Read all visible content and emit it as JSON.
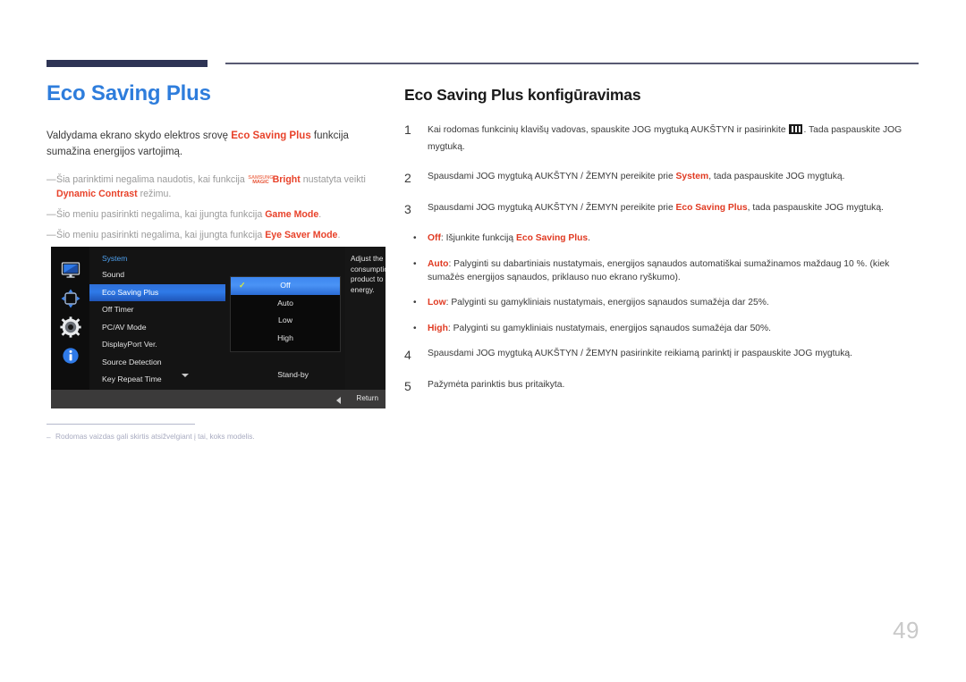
{
  "page": {
    "number": "49"
  },
  "left": {
    "title": "Eco Saving Plus",
    "intro_pre": "Valdydama ekrano skydo elektros srovę ",
    "intro_highlight": "Eco Saving Plus",
    "intro_post": " funkcija sumažina energijos vartojimą.",
    "dash": "—",
    "notes": [
      {
        "pre": "Šia parinktimi negalima naudotis, kai funkcija ",
        "logo_line1": "SAMSUNG",
        "logo_line2": "MAGIC",
        "bold1": "Bright",
        "mid": " nustatyta veikti ",
        "bold2": "Dynamic Contrast",
        "post": " režimu."
      },
      {
        "pre": "Šio meniu pasirinkti negalima, kai įjungta funkcija ",
        "bold1": "Game Mode",
        "post": "."
      },
      {
        "pre": "Šio meniu pasirinkti negalima, kai įjungta funkcija ",
        "bold1": "Eye Saver Mode",
        "post": "."
      }
    ],
    "footnote": {
      "dash": "–",
      "text": "Rodomas vaizdas gali skirtis atsižvelgiant į tai, koks modelis."
    }
  },
  "osd": {
    "section_title": "System",
    "sidebar_icons": [
      "monitor-icon",
      "screen-adjust-icon",
      "gear-icon",
      "info-icon"
    ],
    "menu_items": [
      {
        "label": "Sound",
        "selected": false
      },
      {
        "label": "Eco Saving Plus",
        "selected": true
      },
      {
        "label": "Off Timer",
        "selected": false
      },
      {
        "label": "PC/AV Mode",
        "selected": false
      },
      {
        "label": "DisplayPort Ver.",
        "selected": false
      },
      {
        "label": "Source Detection",
        "selected": false
      },
      {
        "label": "Key Repeat Time",
        "selected": false
      }
    ],
    "standby_value": "Stand-by",
    "options": [
      {
        "label": "Off",
        "selected": true
      },
      {
        "label": "Auto",
        "selected": false
      },
      {
        "label": "Low",
        "selected": false
      },
      {
        "label": "High",
        "selected": false
      }
    ],
    "check_glyph": "✓",
    "description": "Adjust the power consumption of the product to save energy.",
    "return_label": "Return"
  },
  "right": {
    "title": "Eco Saving Plus konfigūravimas",
    "steps": [
      {
        "num": "1",
        "pre": "Kai rodomas funkcinių klavišų vadovas, spauskite JOG mygtuką AUKŠTYN ir pasirinkite ",
        "icon": "menu-key-icon",
        "post": ". Tada paspauskite JOG mygtuką."
      },
      {
        "num": "2",
        "pre": "Spausdami JOG mygtuką AUKŠTYN / ŽEMYN pereikite prie ",
        "bold1": "System",
        "post": ", tada paspauskite JOG mygtuką."
      },
      {
        "num": "3",
        "pre": "Spausdami JOG mygtuką AUKŠTYN / ŽEMYN pereikite prie ",
        "bold1": "Eco Saving Plus",
        "post": ", tada paspauskite JOG mygtuką."
      }
    ],
    "bullet_char": "•",
    "bullets": [
      {
        "bold1": "Off",
        "mid": ": Išjunkite funkciją ",
        "bold2": "Eco Saving Plus",
        "post": "."
      },
      {
        "bold1": "Auto",
        "mid": ": Palyginti su dabartiniais nustatymais, energijos sąnaudos automatiškai sumažinamos maždaug 10 %. (kiek sumažės energijos sąnaudos, priklauso nuo ekrano ryškumo).",
        "post": ""
      },
      {
        "bold1": "Low",
        "mid": ": Palyginti su gamykliniais nustatymais, energijos sąnaudos sumažėja dar 25%.",
        "post": ""
      },
      {
        "bold1": "High",
        "mid": ": Palyginti su gamykliniais nustatymais, energijos sąnaudos sumažėja dar 50%.",
        "post": ""
      }
    ],
    "steps_after": [
      {
        "num": "4",
        "text": "Spausdami JOG mygtuką AUKŠTYN / ŽEMYN pasirinkite reikiamą parinktį ir paspauskite JOG mygtuką."
      },
      {
        "num": "5",
        "text": "Pažymėta parinktis bus pritaikyta."
      }
    ]
  }
}
